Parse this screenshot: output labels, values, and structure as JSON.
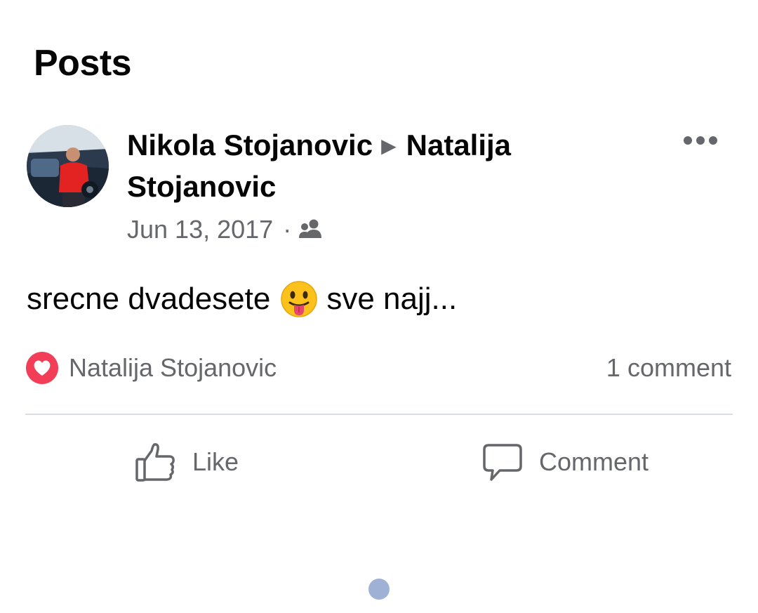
{
  "section": {
    "title": "Posts"
  },
  "post": {
    "author": "Nikola Stojanovic",
    "arrow": "▶",
    "recipient": "Natalija Stojanovic",
    "date": "Jun 13, 2017",
    "separator": "·",
    "audience_icon": "friends-icon",
    "more_icon": "more-options-icon",
    "text_before_emoji": "srecne dvadesete",
    "emoji": "tongue-out-emoji",
    "text_after_emoji": "sve najj...",
    "reactions": {
      "icon": "love-reaction-icon",
      "reactor_name": "Natalija Stojanovic"
    },
    "comment_count": "1 comment",
    "actions": {
      "like_label": "Like",
      "comment_label": "Comment"
    }
  },
  "colors": {
    "text_primary": "#050505",
    "text_secondary": "#65676b",
    "love_red": "#f33e58",
    "divider": "#dadde1",
    "loading_dot": "#9fb1d4"
  }
}
